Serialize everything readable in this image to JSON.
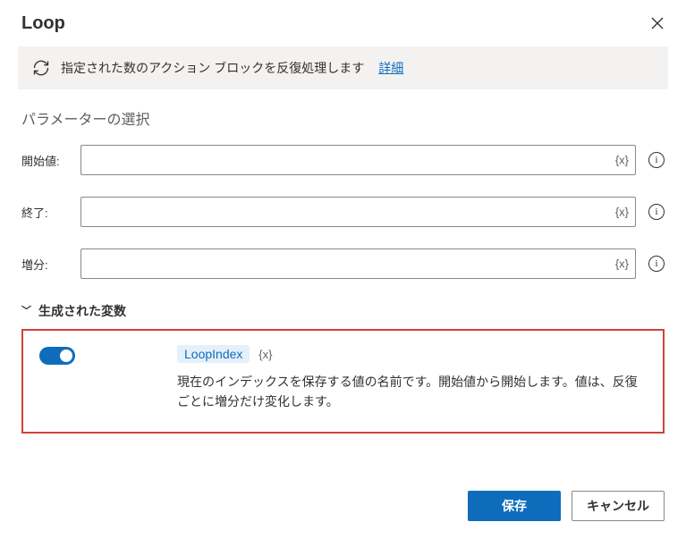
{
  "dialog": {
    "title": "Loop",
    "description_text": "指定された数のアクション ブロックを反復処理します",
    "details_link": "詳細"
  },
  "params": {
    "section_title": "パラメーターの選択",
    "rows": [
      {
        "label": "開始値:",
        "value": "",
        "var_token": "{x}"
      },
      {
        "label": "終了:",
        "value": "",
        "var_token": "{x}"
      },
      {
        "label": "増分:",
        "value": "",
        "var_token": "{x}"
      }
    ]
  },
  "generated": {
    "header": "生成された変数",
    "toggle_on": true,
    "var_name": "LoopIndex",
    "var_token": "{x}",
    "description": "現在のインデックスを保存する値の名前です。開始値から開始します。値は、反復ごとに増分だけ変化します。"
  },
  "footer": {
    "save": "保存",
    "cancel": "キャンセル"
  }
}
